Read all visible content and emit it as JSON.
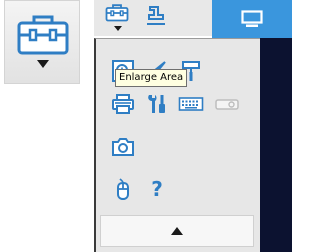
{
  "tooltip": {
    "text": "Enlarge Area"
  },
  "icons": {
    "main_toolbox": "toolbox-icon",
    "dropdown_caret": "caret-down-icon",
    "top_toolbox": "toolbox-icon",
    "top_stamp": "stamp-icon",
    "monitor": "monitor-icon",
    "enlarge_area": "magnifier-square-icon",
    "draw": "pen-icon",
    "roller": "paint-roller-icon",
    "print": "printer-icon",
    "tools": "wrench-screwdriver-icon",
    "keyboard": "keyboard-icon",
    "projector": "projector-icon",
    "camera": "camera-icon",
    "mouse": "mouse-icon",
    "help": "question-icon",
    "scroll_up": "caret-up-icon"
  },
  "help_label": "?",
  "colors": {
    "accent": "#2f7ec4",
    "active_tab": "#3a96dd",
    "background_dark": "#0c1230"
  }
}
